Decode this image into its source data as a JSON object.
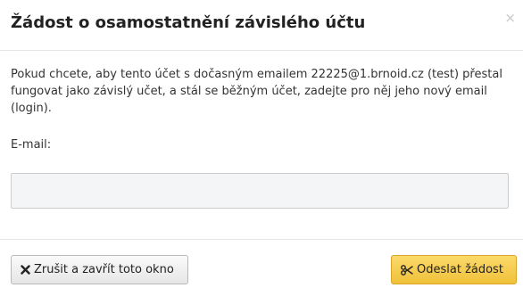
{
  "dialog": {
    "title": "Žádost o osamostatnění závislého účtu",
    "close_symbol": "×",
    "close_icon": "close-icon"
  },
  "body": {
    "description": "Pokud chcete, aby tento účet s dočasným emailem 22225@1.brnoid.cz (test) přestal fungovat jako závislý učet, a stál se běžným účet, zadejte pro něj jeho nový email (login).",
    "email_label": "E-mail:",
    "email_value": "",
    "email_placeholder": ""
  },
  "footer": {
    "cancel_label": "Zrušit a zavřít toto okno",
    "cancel_icon": "close-icon",
    "submit_label": "Odeslat žádost",
    "submit_icon": "scissors-icon"
  },
  "colors": {
    "submit_button": "#f5c94d",
    "cancel_button": "#eeeeee",
    "input_background": "#f4f5f7"
  }
}
